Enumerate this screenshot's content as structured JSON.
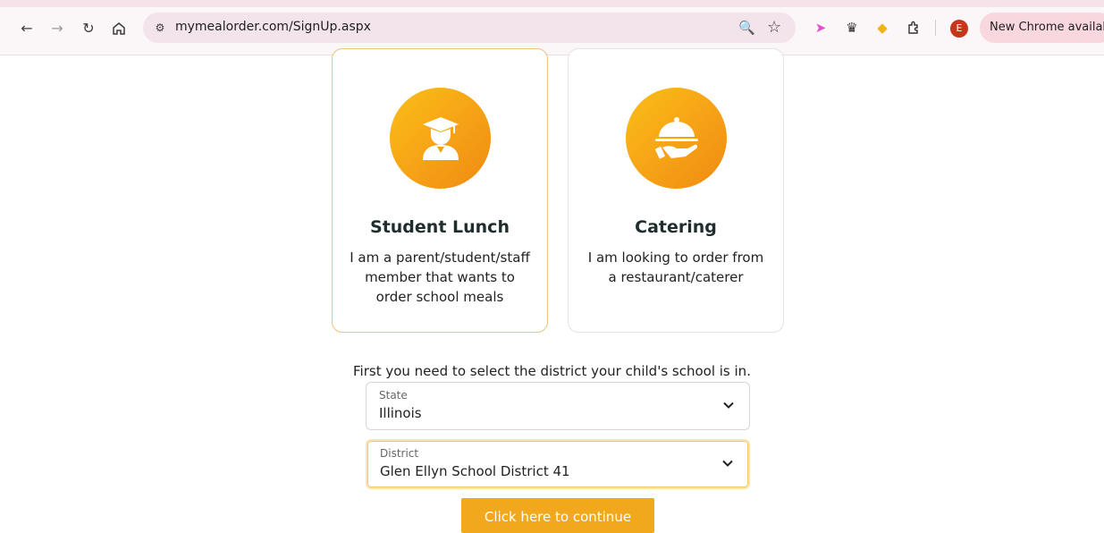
{
  "browser": {
    "url": "mymealorder.com/SignUp.aspx",
    "profile_initial": "E",
    "update_label": "New Chrome available"
  },
  "cards": [
    {
      "title": "Student Lunch",
      "description": "I am a parent/student/staff member that wants to order school meals",
      "icon": "graduate-icon",
      "selected": true
    },
    {
      "title": "Catering",
      "description": "I am looking to order from a restaurant/caterer",
      "icon": "serving-cloche-icon",
      "selected": false
    }
  ],
  "district_prompt": "First you need to select the district your child's school is in.",
  "state_select": {
    "label": "State",
    "value": "Illinois"
  },
  "district_select": {
    "label": "District",
    "value": "Glen Ellyn School District 41"
  },
  "continue_label": "Click here to continue",
  "colors": {
    "accent": "#f2a81d",
    "circle_start": "#fbbf18",
    "circle_end": "#f08a12"
  }
}
